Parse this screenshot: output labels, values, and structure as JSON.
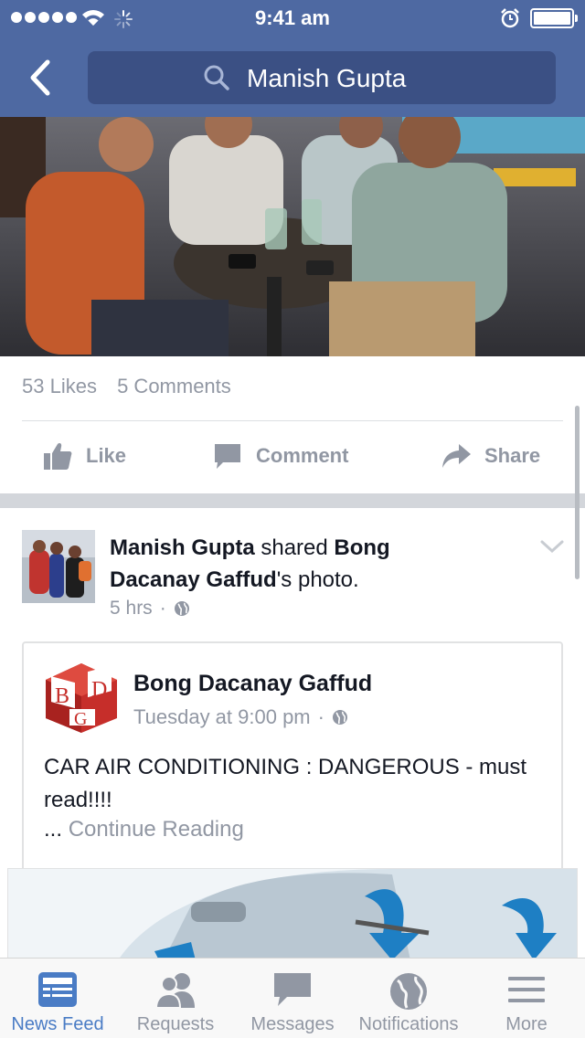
{
  "status_bar": {
    "time": "9:41 am"
  },
  "header": {
    "search_text": "Manish Gupta"
  },
  "post_stats": {
    "likes": "53 Likes",
    "comments": "5 Comments"
  },
  "actions": {
    "like": "Like",
    "comment": "Comment",
    "share": "Share"
  },
  "post": {
    "author": "Manish Gupta",
    "verb": "shared",
    "owner_line1": "Bong",
    "owner_line2": "Dacanay Gaffud",
    "owner_suffix": "'s photo.",
    "time": "5 hrs",
    "dot": "·",
    "shared": {
      "logo_letters": [
        "B",
        "D",
        "G"
      ],
      "name": "Bong Dacanay Gaffud",
      "time": "Tuesday at 9:00 pm",
      "dot": "·",
      "text": "CAR AIR CONDITIONING : DANGEROUS - must read!!!!",
      "ellipsis": "...",
      "continue": "Continue Reading"
    }
  },
  "tabs": [
    {
      "label": "News Feed",
      "icon": "news-feed-icon",
      "active": true
    },
    {
      "label": "Requests",
      "icon": "friends-icon",
      "active": false
    },
    {
      "label": "Messages",
      "icon": "messages-icon",
      "active": false
    },
    {
      "label": "Notifications",
      "icon": "globe-icon",
      "active": false
    },
    {
      "label": "More",
      "icon": "menu-icon",
      "active": false
    }
  ],
  "colors": {
    "header": "#4e69a2",
    "search_bg": "#3b5084",
    "active_tab": "#4a7cc5",
    "muted_text": "#9197a3"
  }
}
